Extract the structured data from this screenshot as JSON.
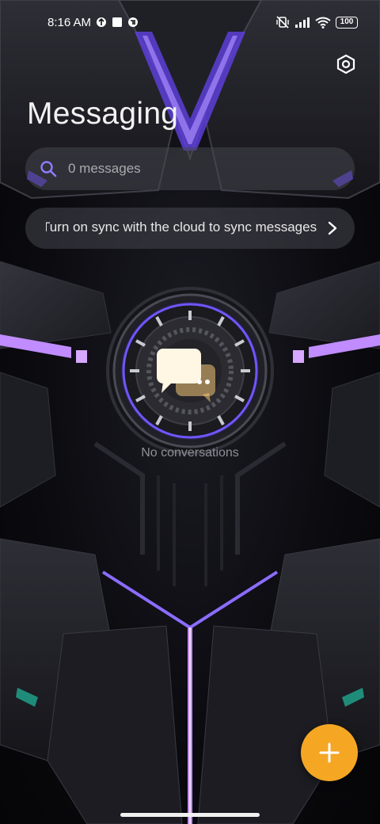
{
  "status_bar": {
    "time": "8:16 AM",
    "battery": "100"
  },
  "header": {
    "title": "Messaging",
    "settings_icon": "settings-hexagon-icon"
  },
  "search": {
    "placeholder": "0 messages",
    "icon": "search-icon"
  },
  "sync_banner": {
    "text": "Turn on sync with the cloud to sync messages",
    "icon": "chevron-right-icon"
  },
  "empty_state": {
    "text": "No conversations",
    "icon": "chat-bubbles-icon"
  },
  "fab": {
    "icon": "plus-icon",
    "color": "#f5a623"
  },
  "colors": {
    "accent": "#f5a623",
    "neon": "#b078ff",
    "panel": "rgba(70,70,78,0.55)"
  }
}
